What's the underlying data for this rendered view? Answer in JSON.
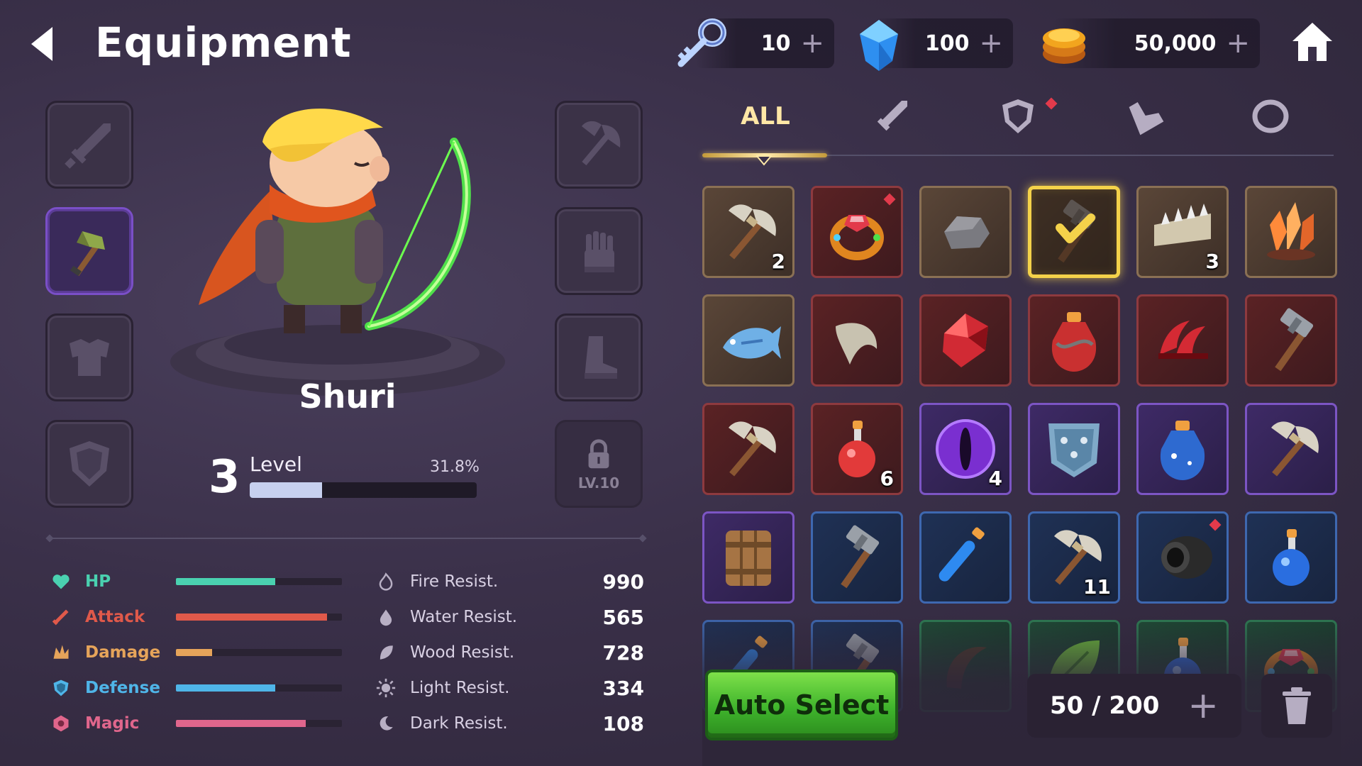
{
  "header": {
    "title": "Equipment",
    "currencies": [
      {
        "name": "keys",
        "value": "10",
        "icon": "key-icon"
      },
      {
        "name": "gems",
        "value": "100",
        "icon": "gem-icon"
      },
      {
        "name": "gold",
        "value": "50,000",
        "icon": "coin-icon"
      }
    ],
    "plus": "+"
  },
  "hero": {
    "name": "Shuri",
    "level": "3",
    "level_label": "Level",
    "level_progress_text": "31.8%",
    "level_progress": 0.318
  },
  "slots": {
    "left": [
      {
        "name": "weapon-slot",
        "icon": "sword-icon",
        "equipped": false
      },
      {
        "name": "tool-slot",
        "icon": "hammer-icon",
        "equipped": true
      },
      {
        "name": "armor-slot",
        "icon": "chestplate-icon",
        "equipped": false
      },
      {
        "name": "shield-slot",
        "icon": "shield-icon",
        "equipped": false
      }
    ],
    "right": [
      {
        "name": "axe-slot",
        "icon": "axe-icon",
        "equipped": false
      },
      {
        "name": "glove-slot",
        "icon": "glove-icon",
        "equipped": false
      },
      {
        "name": "boots-slot",
        "icon": "boot-icon",
        "equipped": false
      },
      {
        "name": "locked-slot",
        "icon": "lock-icon",
        "locked_label": "LV.10"
      }
    ]
  },
  "stats": [
    {
      "label": "HP",
      "color": "#4ad1b0",
      "fill": 0.6
    },
    {
      "label": "Attack",
      "color": "#e0594a",
      "fill": 0.91
    },
    {
      "label": "Damage",
      "color": "#e6a45a",
      "fill": 0.22
    },
    {
      "label": "Defense",
      "color": "#4fb5e8",
      "fill": 0.6
    },
    {
      "label": "Magic",
      "color": "#e0668c",
      "fill": 0.78
    }
  ],
  "resistances": [
    {
      "label": "Fire Resist.",
      "value": "990",
      "icon": "fire-icon"
    },
    {
      "label": "Water Resist.",
      "value": "565",
      "icon": "water-drop-icon"
    },
    {
      "label": "Wood Resist.",
      "value": "728",
      "icon": "leaf-icon"
    },
    {
      "label": "Light Resist.",
      "value": "334",
      "icon": "sun-icon"
    },
    {
      "label": "Dark Resist.",
      "value": "108",
      "icon": "moon-icon"
    }
  ],
  "tabs": [
    {
      "label": "ALL",
      "active": true
    },
    {
      "icon": "sword-icon"
    },
    {
      "icon": "shield-icon",
      "badge": true
    },
    {
      "icon": "boot-icon"
    },
    {
      "icon": "ring-icon"
    }
  ],
  "inventory": [
    {
      "icon": "axe",
      "rarity": "brown",
      "count": "2"
    },
    {
      "icon": "ring",
      "rarity": "red",
      "badge": true
    },
    {
      "icon": "stone",
      "rarity": "brown"
    },
    {
      "icon": "check",
      "rarity": "brown",
      "selected": true
    },
    {
      "icon": "jaw",
      "rarity": "brown",
      "count": "3"
    },
    {
      "icon": "crystal",
      "rarity": "brown"
    },
    {
      "icon": "fish",
      "rarity": "brown"
    },
    {
      "icon": "fang",
      "rarity": "red"
    },
    {
      "icon": "ruby",
      "rarity": "red"
    },
    {
      "icon": "potion-red-large",
      "rarity": "red"
    },
    {
      "icon": "claw",
      "rarity": "red"
    },
    {
      "icon": "hammer",
      "rarity": "red"
    },
    {
      "icon": "axe",
      "rarity": "red"
    },
    {
      "icon": "potion-red",
      "rarity": "red",
      "count": "6"
    },
    {
      "icon": "eye",
      "rarity": "purple",
      "count": "4"
    },
    {
      "icon": "shield",
      "rarity": "purple"
    },
    {
      "icon": "potion-blue-large",
      "rarity": "purple"
    },
    {
      "icon": "axe",
      "rarity": "purple"
    },
    {
      "icon": "wood-shield",
      "rarity": "purple"
    },
    {
      "icon": "hammer",
      "rarity": "blue"
    },
    {
      "icon": "vial-blue",
      "rarity": "blue"
    },
    {
      "icon": "axe",
      "rarity": "blue",
      "count": "11"
    },
    {
      "icon": "cannon",
      "rarity": "blue",
      "badge": true
    },
    {
      "icon": "potion-blue",
      "rarity": "blue"
    },
    {
      "icon": "vial-blue",
      "rarity": "blue"
    },
    {
      "icon": "hammer",
      "rarity": "blue"
    },
    {
      "icon": "horn",
      "rarity": "green"
    },
    {
      "icon": "leaf",
      "rarity": "green"
    },
    {
      "icon": "potion-blue",
      "rarity": "green"
    },
    {
      "icon": "ring",
      "rarity": "green"
    }
  ],
  "footer": {
    "auto_select": "Auto Select",
    "capacity": "50 / 200",
    "plus": "+"
  }
}
